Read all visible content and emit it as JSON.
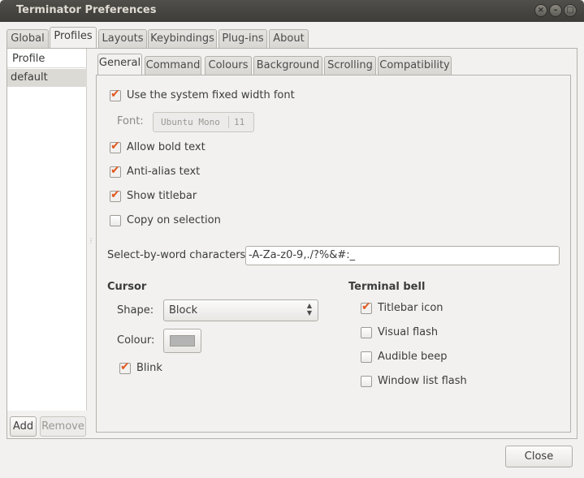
{
  "window": {
    "title": "Terminator Preferences"
  },
  "top_tabs": [
    "Global",
    "Profiles",
    "Layouts",
    "Keybindings",
    "Plug-ins",
    "About"
  ],
  "profiles": {
    "header": "Profile",
    "items": [
      "default"
    ],
    "add_label": "Add",
    "remove_label": "Remove"
  },
  "sub_tabs": [
    "General",
    "Command",
    "Colours",
    "Background",
    "Scrolling",
    "Compatibility"
  ],
  "general": {
    "use_system_font": {
      "label": "Use the system fixed width font",
      "checked": true
    },
    "font_label": "Font:",
    "font_name": "Ubuntu Mono",
    "font_size": "11",
    "allow_bold": {
      "label": "Allow bold text",
      "checked": true
    },
    "anti_alias": {
      "label": "Anti-alias text",
      "checked": true
    },
    "show_titlebar": {
      "label": "Show titlebar",
      "checked": true
    },
    "copy_on_selection": {
      "label": "Copy on selection",
      "checked": false
    },
    "word_chars_label": "Select-by-word characters:",
    "word_chars_value": "-A-Za-z0-9,./?%&#:_"
  },
  "cursor": {
    "heading": "Cursor",
    "shape_label": "Shape:",
    "shape_value": "Block",
    "colour_label": "Colour:",
    "colour_value": "#b4b4b4",
    "blink": {
      "label": "Blink",
      "checked": true
    }
  },
  "bell": {
    "heading": "Terminal bell",
    "titlebar_icon": {
      "label": "Titlebar icon",
      "checked": true
    },
    "visual_flash": {
      "label": "Visual flash",
      "checked": false
    },
    "audible_beep": {
      "label": "Audible beep",
      "checked": false
    },
    "window_list_flash": {
      "label": "Window list flash",
      "checked": false
    }
  },
  "footer": {
    "close_label": "Close"
  },
  "colors": {
    "accent": "#e0581e",
    "titlebar": "#3d3c38",
    "background": "#f2f1f0"
  }
}
